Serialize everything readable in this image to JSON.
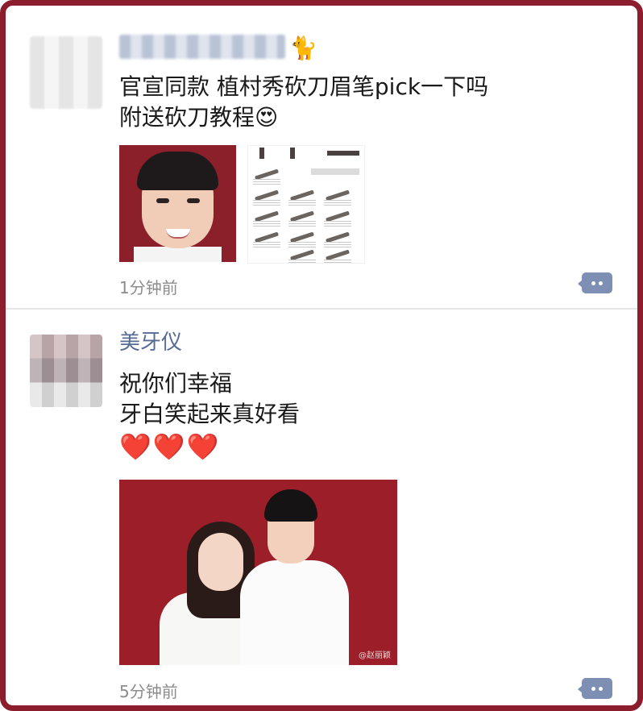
{
  "posts": [
    {
      "author_name": "",
      "author_emoji": "🐈",
      "text_lines": [
        "官宣同款 植村秀砍刀眉笔pick一下吗",
        "附送砍刀教程😍"
      ],
      "time": "1分钟前"
    },
    {
      "author_name": "美牙仪",
      "text_lines": [
        "祝你们幸福",
        "牙白笑起来真好看"
      ],
      "hearts": "❤️❤️❤️",
      "image_watermark": "@赵丽颖",
      "time": "5分钟前"
    }
  ],
  "icons": {
    "comment": "comment-bubble-icon"
  },
  "colors": {
    "frame": "#8b1d2c",
    "name": "#576b95",
    "time": "#8c8c8c",
    "comment_button": "#7d8fb2",
    "photo_background": "#9b1e28"
  }
}
